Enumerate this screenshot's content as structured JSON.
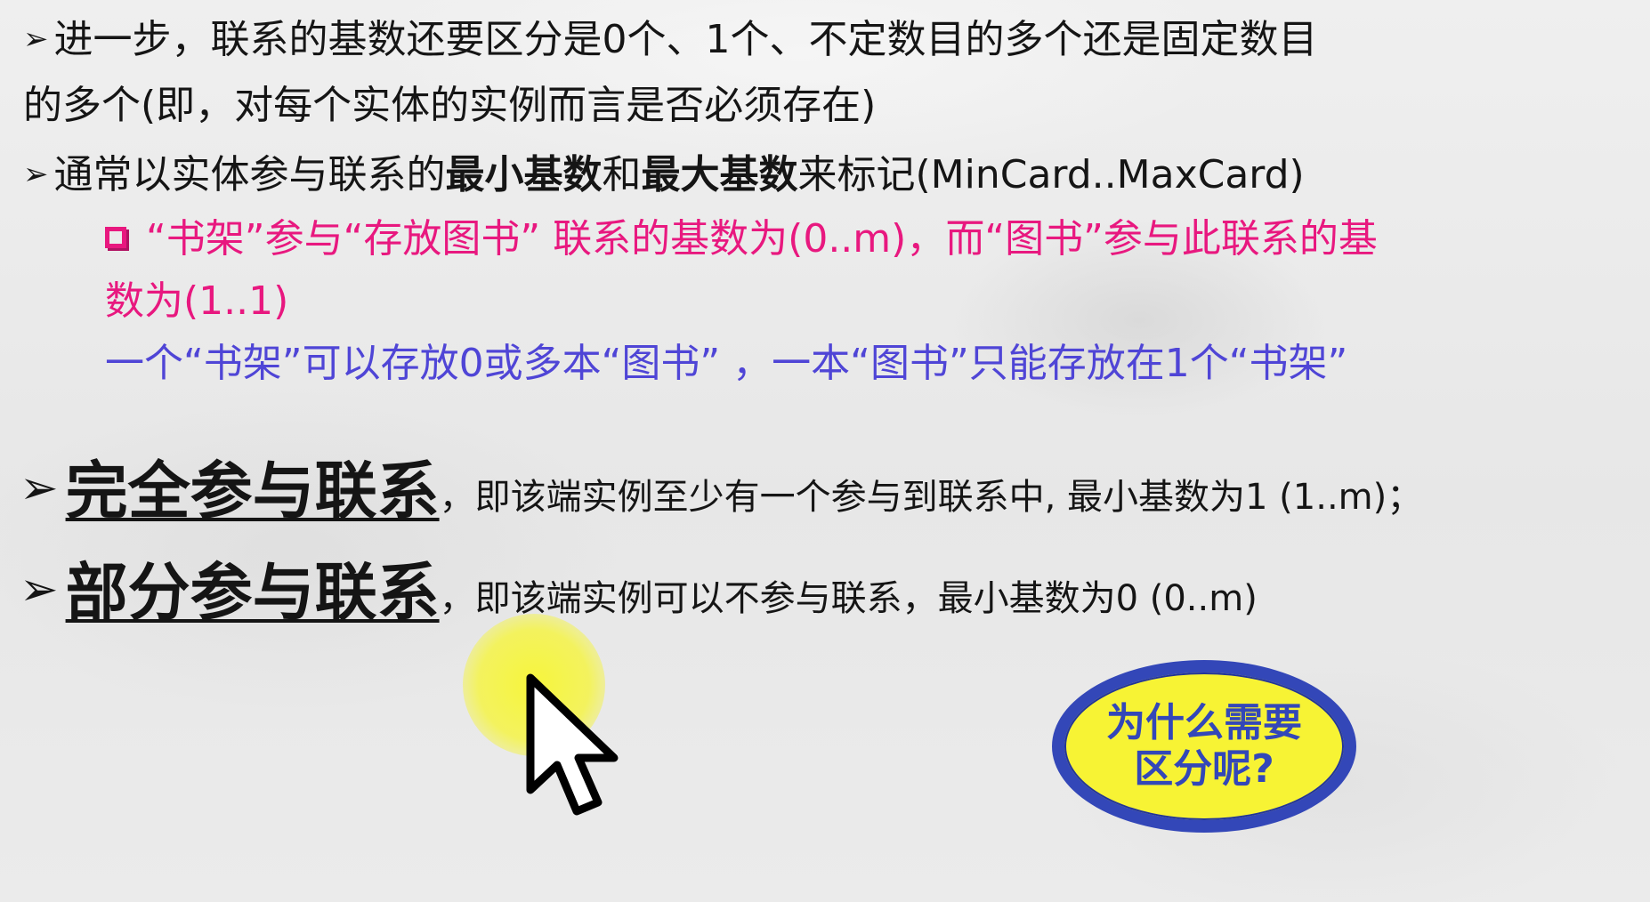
{
  "slide": {
    "line1": "进一步，联系的基数还要区分是0个、1个、不定数目的多个还是固定数目",
    "line2": "的多个(即，对每个实体的实例而言是否必须存在)",
    "line3": {
      "pre": "通常以实体参与联系的",
      "bold1": "最小基数",
      "mid": "和",
      "bold2": "最大基数",
      "post": "来标记(MinCard..MaxCard)"
    },
    "example1": "“书架”参与“存放图书” 联系的基数为(0..m)，而“图书”参与此联系的基",
    "example2": "数为(1..1)",
    "example3": "一个“书架”可以存放0或多本“图书” ，一本“图书”只能存放在1个“书架”",
    "total": {
      "term": "完全参与联系",
      "desc": "，即该端实例至少有一个参与到联系中, 最小基数为1 (1..m)；"
    },
    "partial": {
      "term": "部分参与联系",
      "desc": "，即该端实例可以不参与联系，最小基数为0 (0..m)"
    },
    "callout": "为什么需要\n区分呢?"
  },
  "icons": {
    "bullet": "arrowhead-bullet-icon",
    "checkbox": "square-bullet-icon",
    "cursor": "mouse-pointer-icon"
  },
  "colors": {
    "text": "#151515",
    "pink": "#e8187f",
    "purple": "#4f45d6",
    "callout_fill": "#f7f334",
    "callout_border": "#3347b8",
    "cursor_halo": "#f7f632"
  }
}
